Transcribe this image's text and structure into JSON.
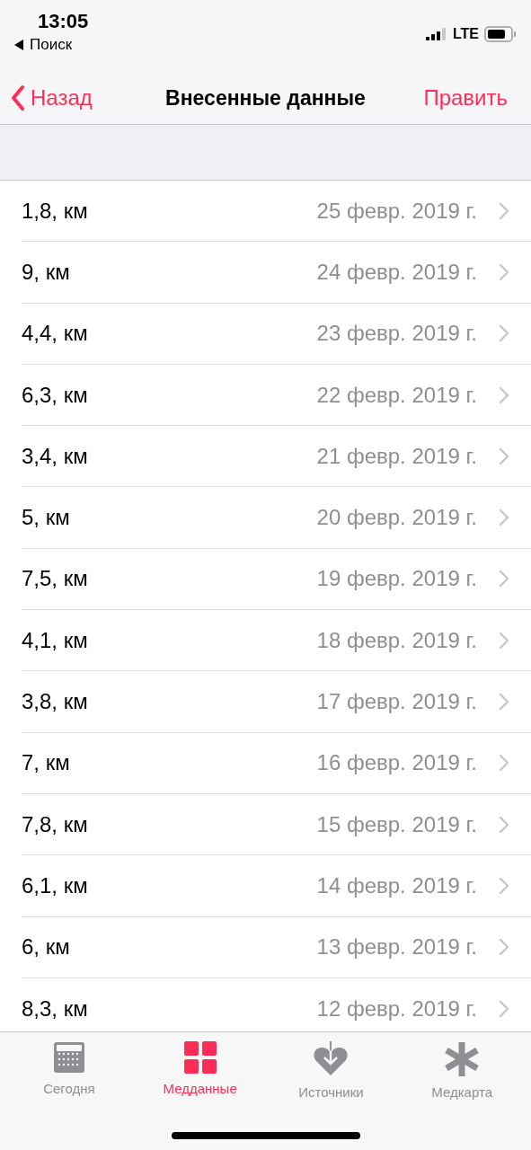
{
  "status_bar": {
    "time": "13:05",
    "back_app": "Поиск",
    "network": "LTE"
  },
  "nav": {
    "back": "Назад",
    "title": "Внесенные данные",
    "action": "Править"
  },
  "rows": [
    {
      "value": "1,8, км",
      "date": "25 февр. 2019 г."
    },
    {
      "value": "9, км",
      "date": "24 февр. 2019 г."
    },
    {
      "value": "4,4, км",
      "date": "23 февр. 2019 г."
    },
    {
      "value": "6,3, км",
      "date": "22 февр. 2019 г."
    },
    {
      "value": "3,4, км",
      "date": "21 февр. 2019 г."
    },
    {
      "value": "5, км",
      "date": "20 февр. 2019 г."
    },
    {
      "value": "7,5, км",
      "date": "19 февр. 2019 г."
    },
    {
      "value": "4,1, км",
      "date": "18 февр. 2019 г."
    },
    {
      "value": "3,8, км",
      "date": "17 февр. 2019 г."
    },
    {
      "value": "7, км",
      "date": "16 февр. 2019 г."
    },
    {
      "value": "7,8, км",
      "date": "15 февр. 2019 г."
    },
    {
      "value": "6,1, км",
      "date": "14 февр. 2019 г."
    },
    {
      "value": "6, км",
      "date": "13 февр. 2019 г."
    },
    {
      "value": "8,3, км",
      "date": "12 февр. 2019 г."
    }
  ],
  "tab_bar": [
    {
      "kind": "today",
      "label": "Сегодня",
      "selected": false
    },
    {
      "kind": "health",
      "label": "Медданные",
      "selected": true
    },
    {
      "kind": "sources",
      "label": "Источники",
      "selected": false
    },
    {
      "kind": "medical",
      "label": "Медкарта",
      "selected": false
    }
  ]
}
